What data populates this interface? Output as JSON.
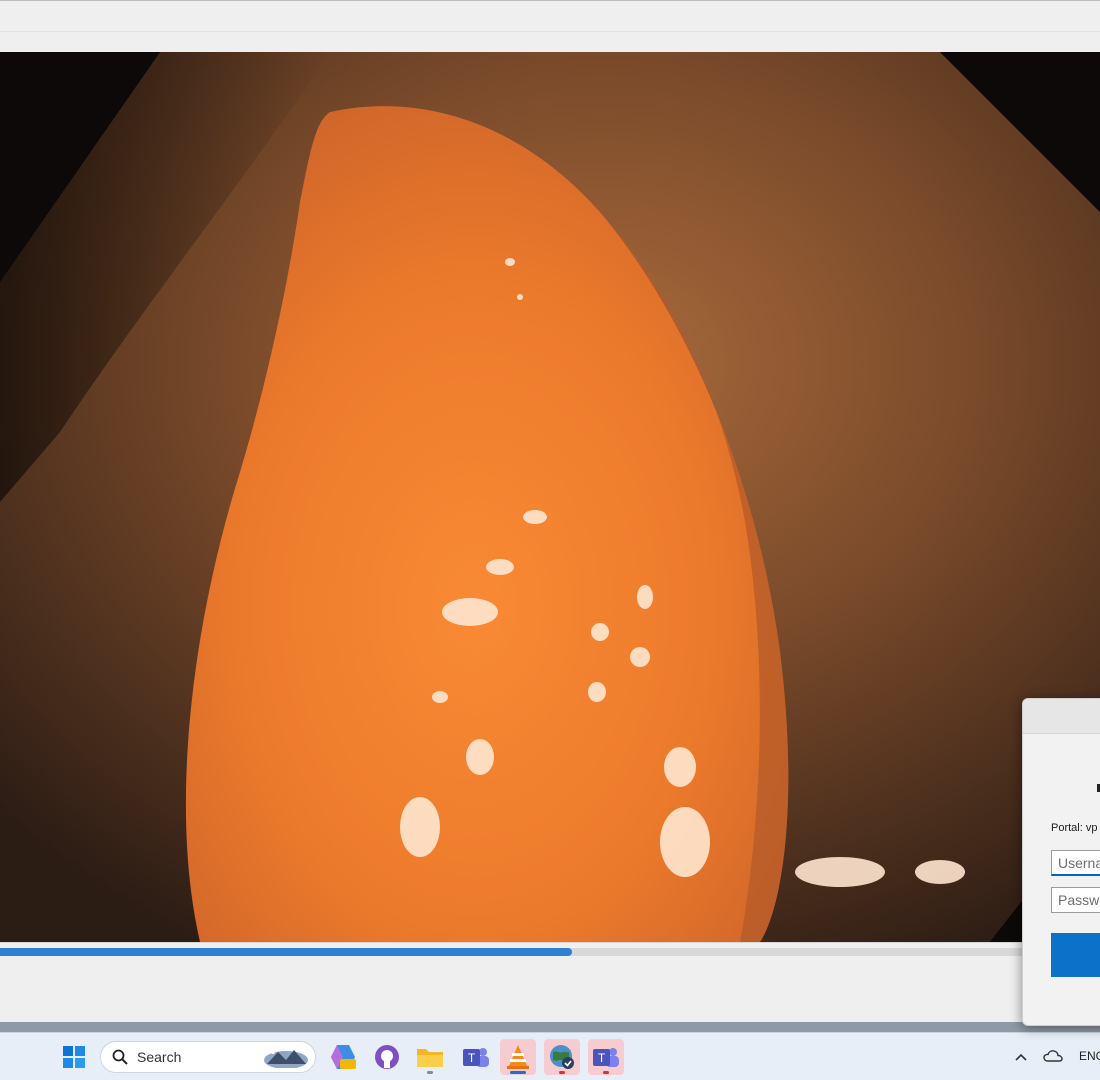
{
  "player": {
    "progress_fraction": 0.52
  },
  "taskbar": {
    "search_label": "Search",
    "icons": [
      "windows-start-icon",
      "search-icon",
      "copilot-pre-icon",
      "github-icon",
      "file-explorer-icon",
      "teams-work-icon",
      "vlc-icon",
      "vpn-globe-icon",
      "teams-icon"
    ],
    "tray_lang": "ENG"
  },
  "login": {
    "portal_label": "Portal: vp",
    "username_placeholder": "Userna",
    "password_placeholder": "Passwo"
  },
  "colors": {
    "accent": "#0a72c9",
    "progress": "#2f7fd2"
  }
}
